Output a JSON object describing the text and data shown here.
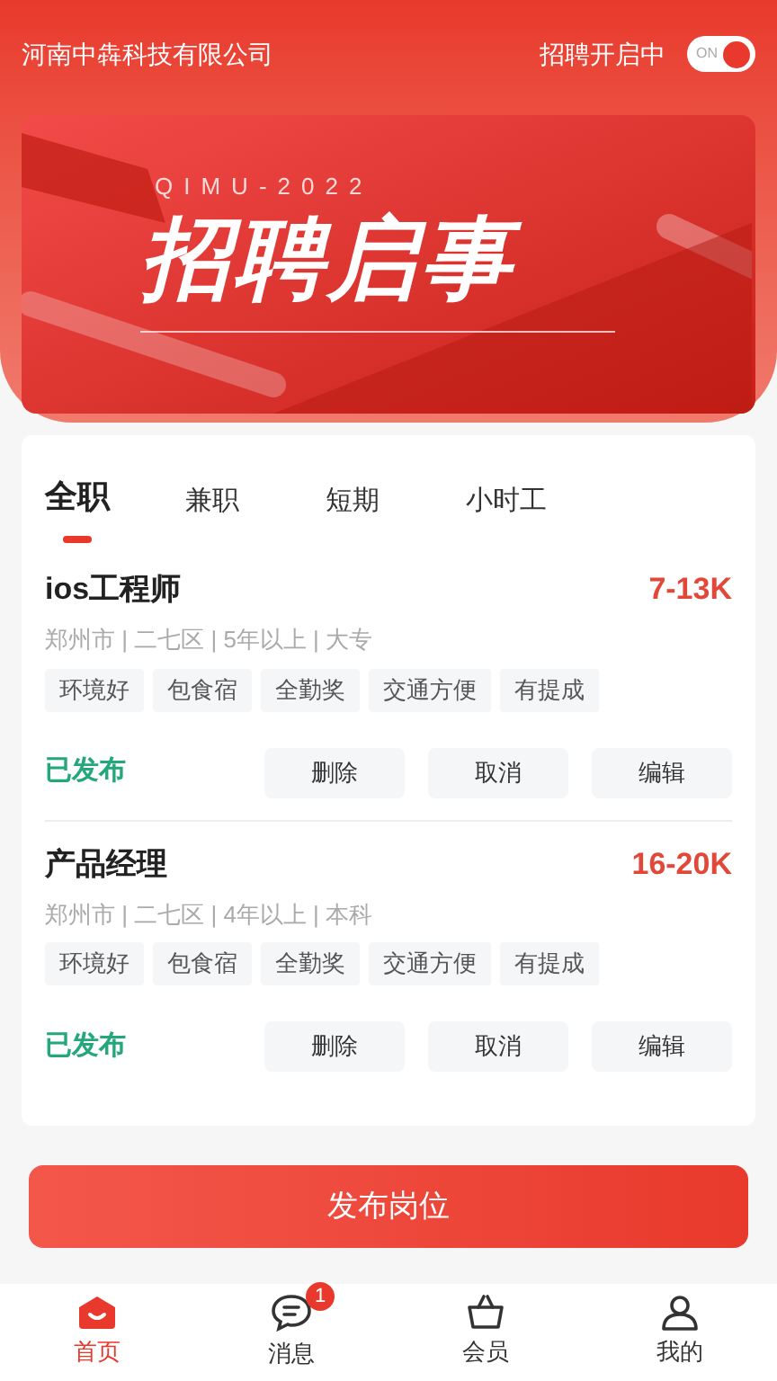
{
  "header": {
    "company": "河南中犇科技有限公司",
    "recruit_label": "招聘开启中",
    "recruit_switch": {
      "label": "ON",
      "on": true
    }
  },
  "banner": {
    "subtitle": "QIMU-2022",
    "title": "招聘启事"
  },
  "tabs": [
    {
      "label": "全职",
      "selected": true
    },
    {
      "label": "兼职",
      "selected": false
    },
    {
      "label": "短期",
      "selected": false
    },
    {
      "label": "小时工",
      "selected": false
    }
  ],
  "jobs": [
    {
      "title": "ios工程师",
      "salary": "7-13K",
      "meta": "郑州市 | 二七区 | 5年以上 | 大专",
      "tags": [
        "环境好",
        "包食宿",
        "全勤奖",
        "交通方便",
        "有提成"
      ],
      "status": "已发布",
      "actions": [
        "删除",
        "取消",
        "编辑"
      ]
    },
    {
      "title": "产品经理",
      "salary": "16-20K",
      "meta": "郑州市 | 二七区 | 4年以上 | 本科",
      "tags": [
        "环境好",
        "包食宿",
        "全勤奖",
        "交通方便",
        "有提成"
      ],
      "status": "已发布",
      "actions": [
        "删除",
        "取消",
        "编辑"
      ]
    }
  ],
  "publish_button": "发布岗位",
  "bottom_nav": [
    {
      "label": "首页",
      "kind": "home",
      "selected": true
    },
    {
      "label": "消息",
      "kind": "chat",
      "selected": false,
      "badge": "1"
    },
    {
      "label": "会员",
      "kind": "bag",
      "selected": false
    },
    {
      "label": "我的",
      "kind": "person",
      "selected": false
    }
  ]
}
